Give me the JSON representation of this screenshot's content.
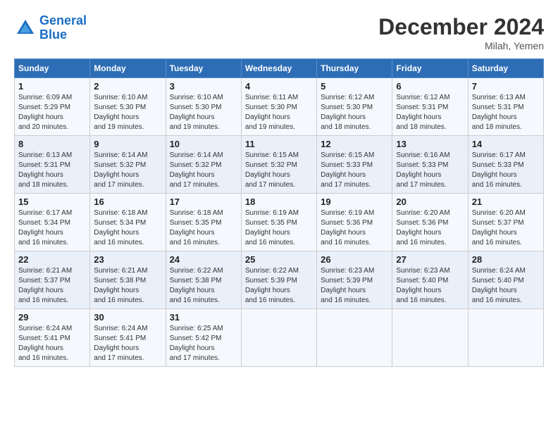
{
  "header": {
    "logo_line1": "General",
    "logo_line2": "Blue",
    "month": "December 2024",
    "location": "Milah, Yemen"
  },
  "days_of_week": [
    "Sunday",
    "Monday",
    "Tuesday",
    "Wednesday",
    "Thursday",
    "Friday",
    "Saturday"
  ],
  "weeks": [
    [
      {
        "day": "1",
        "sunrise": "6:09 AM",
        "sunset": "5:29 PM",
        "daylight": "11 hours and 20 minutes."
      },
      {
        "day": "2",
        "sunrise": "6:10 AM",
        "sunset": "5:30 PM",
        "daylight": "11 hours and 19 minutes."
      },
      {
        "day": "3",
        "sunrise": "6:10 AM",
        "sunset": "5:30 PM",
        "daylight": "11 hours and 19 minutes."
      },
      {
        "day": "4",
        "sunrise": "6:11 AM",
        "sunset": "5:30 PM",
        "daylight": "11 hours and 19 minutes."
      },
      {
        "day": "5",
        "sunrise": "6:12 AM",
        "sunset": "5:30 PM",
        "daylight": "11 hours and 18 minutes."
      },
      {
        "day": "6",
        "sunrise": "6:12 AM",
        "sunset": "5:31 PM",
        "daylight": "11 hours and 18 minutes."
      },
      {
        "day": "7",
        "sunrise": "6:13 AM",
        "sunset": "5:31 PM",
        "daylight": "11 hours and 18 minutes."
      }
    ],
    [
      {
        "day": "8",
        "sunrise": "6:13 AM",
        "sunset": "5:31 PM",
        "daylight": "11 hours and 18 minutes."
      },
      {
        "day": "9",
        "sunrise": "6:14 AM",
        "sunset": "5:32 PM",
        "daylight": "11 hours and 17 minutes."
      },
      {
        "day": "10",
        "sunrise": "6:14 AM",
        "sunset": "5:32 PM",
        "daylight": "11 hours and 17 minutes."
      },
      {
        "day": "11",
        "sunrise": "6:15 AM",
        "sunset": "5:32 PM",
        "daylight": "11 hours and 17 minutes."
      },
      {
        "day": "12",
        "sunrise": "6:15 AM",
        "sunset": "5:33 PM",
        "daylight": "11 hours and 17 minutes."
      },
      {
        "day": "13",
        "sunrise": "6:16 AM",
        "sunset": "5:33 PM",
        "daylight": "11 hours and 17 minutes."
      },
      {
        "day": "14",
        "sunrise": "6:17 AM",
        "sunset": "5:33 PM",
        "daylight": "11 hours and 16 minutes."
      }
    ],
    [
      {
        "day": "15",
        "sunrise": "6:17 AM",
        "sunset": "5:34 PM",
        "daylight": "11 hours and 16 minutes."
      },
      {
        "day": "16",
        "sunrise": "6:18 AM",
        "sunset": "5:34 PM",
        "daylight": "11 hours and 16 minutes."
      },
      {
        "day": "17",
        "sunrise": "6:18 AM",
        "sunset": "5:35 PM",
        "daylight": "11 hours and 16 minutes."
      },
      {
        "day": "18",
        "sunrise": "6:19 AM",
        "sunset": "5:35 PM",
        "daylight": "11 hours and 16 minutes."
      },
      {
        "day": "19",
        "sunrise": "6:19 AM",
        "sunset": "5:36 PM",
        "daylight": "11 hours and 16 minutes."
      },
      {
        "day": "20",
        "sunrise": "6:20 AM",
        "sunset": "5:36 PM",
        "daylight": "11 hours and 16 minutes."
      },
      {
        "day": "21",
        "sunrise": "6:20 AM",
        "sunset": "5:37 PM",
        "daylight": "11 hours and 16 minutes."
      }
    ],
    [
      {
        "day": "22",
        "sunrise": "6:21 AM",
        "sunset": "5:37 PM",
        "daylight": "11 hours and 16 minutes."
      },
      {
        "day": "23",
        "sunrise": "6:21 AM",
        "sunset": "5:38 PM",
        "daylight": "11 hours and 16 minutes."
      },
      {
        "day": "24",
        "sunrise": "6:22 AM",
        "sunset": "5:38 PM",
        "daylight": "11 hours and 16 minutes."
      },
      {
        "day": "25",
        "sunrise": "6:22 AM",
        "sunset": "5:39 PM",
        "daylight": "11 hours and 16 minutes."
      },
      {
        "day": "26",
        "sunrise": "6:23 AM",
        "sunset": "5:39 PM",
        "daylight": "11 hours and 16 minutes."
      },
      {
        "day": "27",
        "sunrise": "6:23 AM",
        "sunset": "5:40 PM",
        "daylight": "11 hours and 16 minutes."
      },
      {
        "day": "28",
        "sunrise": "6:24 AM",
        "sunset": "5:40 PM",
        "daylight": "11 hours and 16 minutes."
      }
    ],
    [
      {
        "day": "29",
        "sunrise": "6:24 AM",
        "sunset": "5:41 PM",
        "daylight": "11 hours and 16 minutes."
      },
      {
        "day": "30",
        "sunrise": "6:24 AM",
        "sunset": "5:41 PM",
        "daylight": "11 hours and 17 minutes."
      },
      {
        "day": "31",
        "sunrise": "6:25 AM",
        "sunset": "5:42 PM",
        "daylight": "11 hours and 17 minutes."
      },
      null,
      null,
      null,
      null
    ]
  ]
}
